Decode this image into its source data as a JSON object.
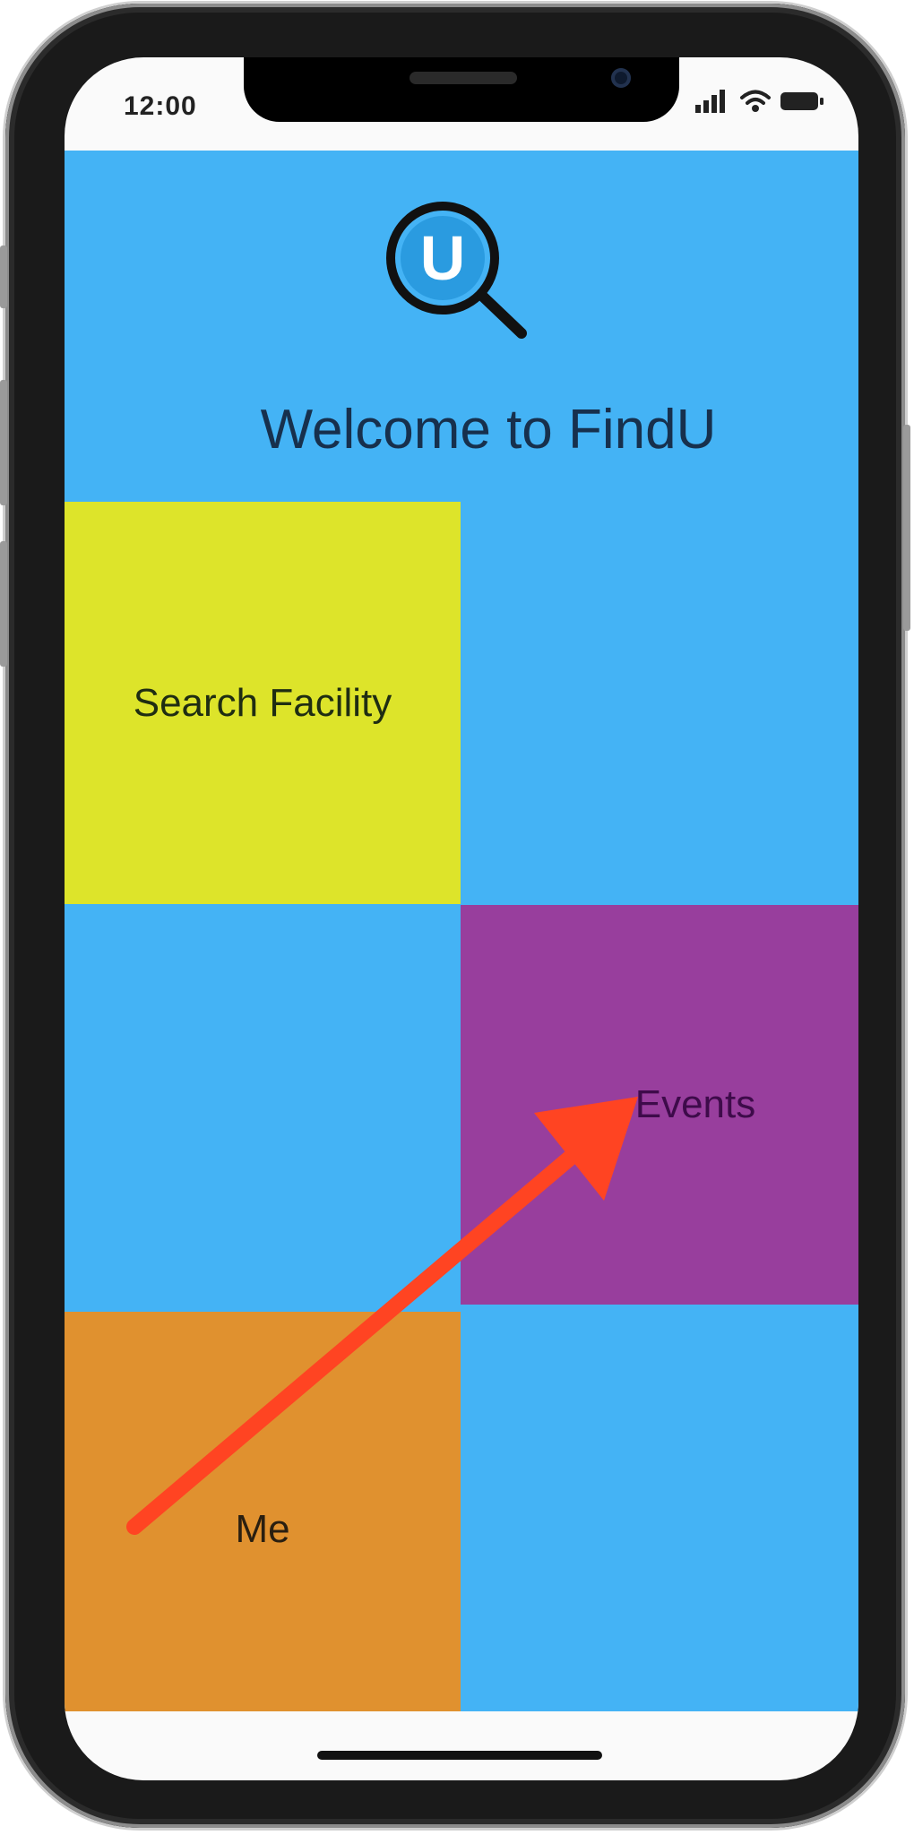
{
  "status_bar": {
    "time": "12:00"
  },
  "app": {
    "logo_letter": "U",
    "title": "Welcome to FindU",
    "tiles": {
      "search_facility": "Search Facility",
      "events": "Events",
      "me": "Me"
    }
  },
  "colors": {
    "background": "#44b3f5",
    "search_tile": "#dde42a",
    "events_tile": "#983e9d",
    "me_tile": "#e0912f",
    "annotation_arrow": "#ff4422"
  },
  "icons": [
    "magnifier-logo-icon",
    "cellular-signal-icon",
    "wifi-icon",
    "battery-icon"
  ]
}
